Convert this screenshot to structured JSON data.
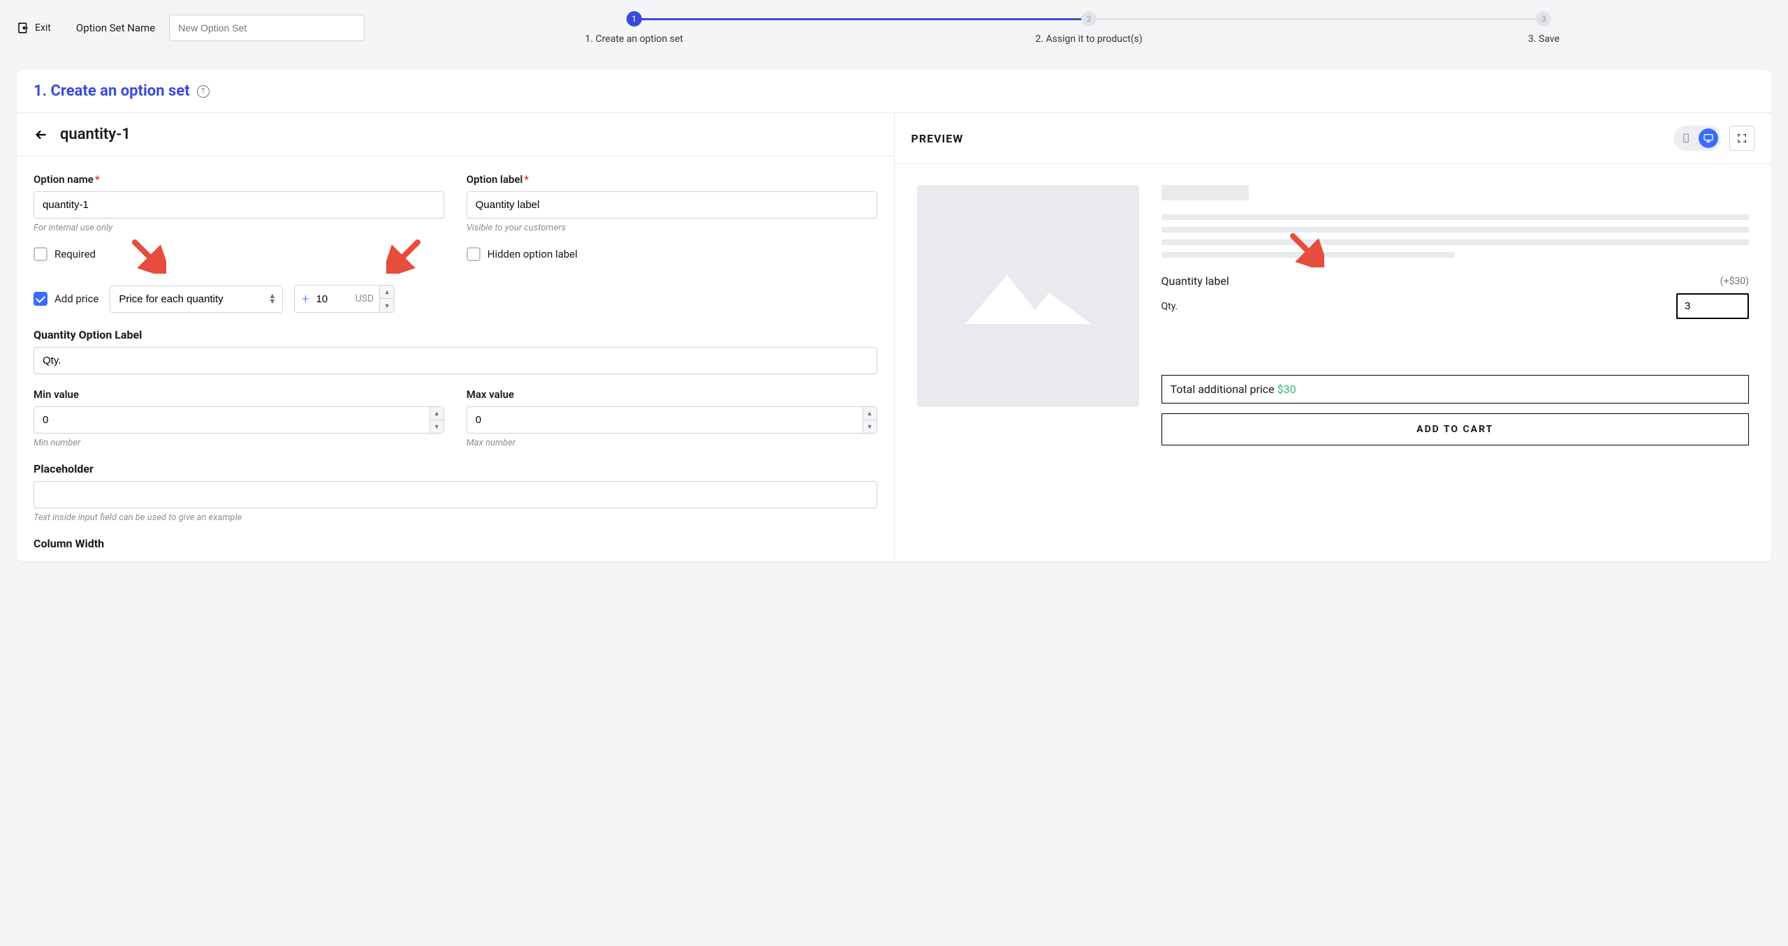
{
  "topbar": {
    "exit_label": "Exit",
    "option_set_name_label": "Option Set Name",
    "option_set_placeholder": "New Option Set"
  },
  "steps": [
    {
      "num": "1",
      "label": "1. Create an option set",
      "active": true
    },
    {
      "num": "2",
      "label": "2. Assign it to product(s)",
      "active": false
    },
    {
      "num": "3",
      "label": "3. Save",
      "active": false
    }
  ],
  "card": {
    "title": "1. Create an option set",
    "sub_title": "quantity-1"
  },
  "form": {
    "option_name_label": "Option name",
    "option_name_value": "quantity-1",
    "option_name_help": "For internal use only",
    "option_label_label": "Option label",
    "option_label_value": "Quantity label",
    "option_label_help": "Visible to your customers",
    "required_label": "Required",
    "hidden_label": "Hidden option label",
    "add_price_label": "Add price",
    "price_type": "Price for each quantity",
    "price_value": "10",
    "price_currency": "USD",
    "qty_option_label_label": "Quantity Option Label",
    "qty_option_label_value": "Qty.",
    "min_label": "Min value",
    "min_value": "0",
    "min_help": "Min number",
    "max_label": "Max value",
    "max_value": "0",
    "max_help": "Max number",
    "placeholder_label": "Placeholder",
    "placeholder_value": "",
    "placeholder_help": "Text inside input field can be used to give an example",
    "column_width_label": "Column Width"
  },
  "preview": {
    "title": "PREVIEW",
    "quantity_label": "Quantity label",
    "price_addon": "(+$30)",
    "qty_short_label": "Qty.",
    "qty_value": "3",
    "total_label": "Total additional price ",
    "total_amount": "$30",
    "add_to_cart": "ADD TO CART"
  }
}
